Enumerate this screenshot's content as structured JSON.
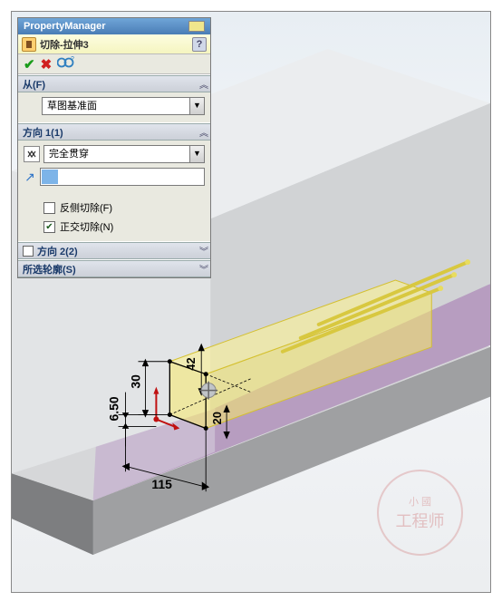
{
  "pm": {
    "title": "PropertyManager",
    "feature_name": "切除-拉伸3",
    "help": "?"
  },
  "from": {
    "label": "从(F)",
    "value": "草图基准面",
    "chev": "︽"
  },
  "dir1": {
    "label": "方向 1(1)",
    "end_condition": "完全贯穿",
    "reverse_cut": "反侧切除(F)",
    "normal_cut": "正交切除(N)",
    "reverse_checked": false,
    "normal_checked": true,
    "chev": "︽"
  },
  "dir2": {
    "label": "方向 2(2)",
    "chev": "︾"
  },
  "contours": {
    "label": "所选轮廓(S)",
    "chev": "︾"
  },
  "dims": {
    "d30": "30",
    "d650": "6.50",
    "d115": "115",
    "d42": "42",
    "d20": "20"
  },
  "watermark": {
    "top": "小 國",
    "bottom": "工程师"
  }
}
